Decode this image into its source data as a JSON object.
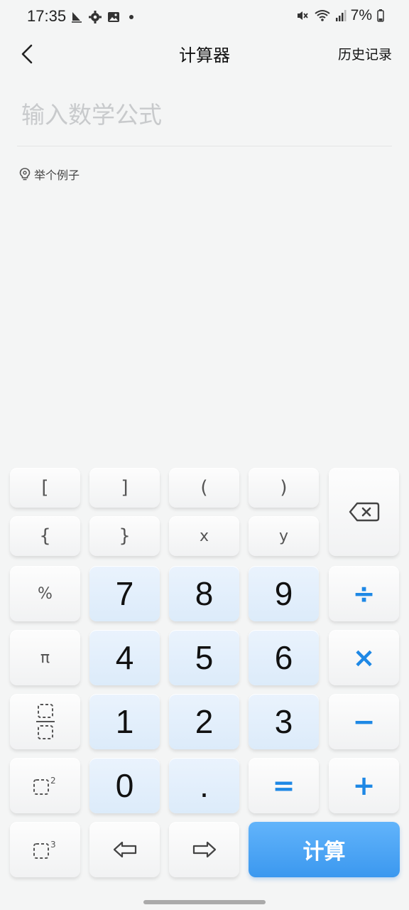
{
  "status_bar": {
    "time": "17:35",
    "battery": "7%",
    "left_icons": [
      "sailing-icon",
      "gear-icon",
      "image-icon",
      "dot-icon"
    ],
    "right_icons": [
      "mute-icon",
      "wifi-icon",
      "signal-icon",
      "battery-icon"
    ]
  },
  "header": {
    "title": "计算器",
    "history_label": "历史记录"
  },
  "input": {
    "placeholder": "输入数学公式",
    "value": ""
  },
  "example": {
    "label": "举个例子",
    "icon": "lightbulb-icon"
  },
  "keypad": {
    "bracket_open_square": "[",
    "bracket_close_square": "]",
    "paren_open": "(",
    "paren_close": ")",
    "brace_open": "{",
    "brace_close": "}",
    "var_x": "x",
    "var_y": "y",
    "backspace_icon": "backspace-icon",
    "percent": "%",
    "pi": "π",
    "fraction_icon": "fraction-icon",
    "square_icon": "square-power-icon",
    "cube_icon": "cube-power-icon",
    "digits": [
      "7",
      "8",
      "9",
      "4",
      "5",
      "6",
      "1",
      "2",
      "3",
      "0"
    ],
    "dot": ".",
    "equals": "=",
    "divide": "÷",
    "multiply": "×",
    "minus": "−",
    "plus": "+",
    "left_arrow_icon": "arrow-left-icon",
    "right_arrow_icon": "arrow-right-icon",
    "calculate": "计算"
  },
  "colors": {
    "accent": "#1e88e5",
    "calculate_button": "#4aa6f6",
    "number_key": "#e3effc",
    "background": "#f4f5f5"
  }
}
